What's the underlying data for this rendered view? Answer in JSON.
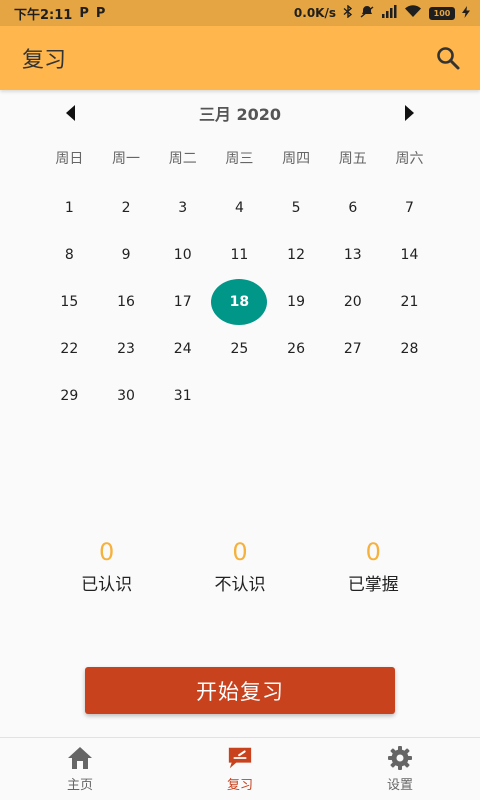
{
  "status_bar": {
    "time": "下午2:11",
    "p_icons": [
      "P",
      "P"
    ],
    "speed": "0.0K/s",
    "battery": "100"
  },
  "app_bar": {
    "title": "复习"
  },
  "calendar": {
    "month_label": "三月 2020",
    "weekdays": [
      "周日",
      "周一",
      "周二",
      "周三",
      "周四",
      "周五",
      "周六"
    ],
    "days": [
      "1",
      "2",
      "3",
      "4",
      "5",
      "6",
      "7",
      "8",
      "9",
      "10",
      "11",
      "12",
      "13",
      "14",
      "15",
      "16",
      "17",
      "18",
      "19",
      "20",
      "21",
      "22",
      "23",
      "24",
      "25",
      "26",
      "27",
      "28",
      "29",
      "30",
      "31"
    ],
    "selected_day": "18"
  },
  "stats": [
    {
      "value": "0",
      "label": "已认识"
    },
    {
      "value": "0",
      "label": "不认识"
    },
    {
      "value": "0",
      "label": "已掌握"
    }
  ],
  "start_button": {
    "label": "开始复习"
  },
  "bottom_nav": [
    {
      "label": "主页",
      "icon": "home-icon"
    },
    {
      "label": "复习",
      "icon": "review-icon",
      "active": true
    },
    {
      "label": "设置",
      "icon": "gear-icon"
    }
  ],
  "colors": {
    "status_bar": "#e5a542",
    "app_bar": "#ffb74d",
    "selected_day": "#009688",
    "stat_value": "#f5b13c",
    "accent": "#c8421e"
  }
}
